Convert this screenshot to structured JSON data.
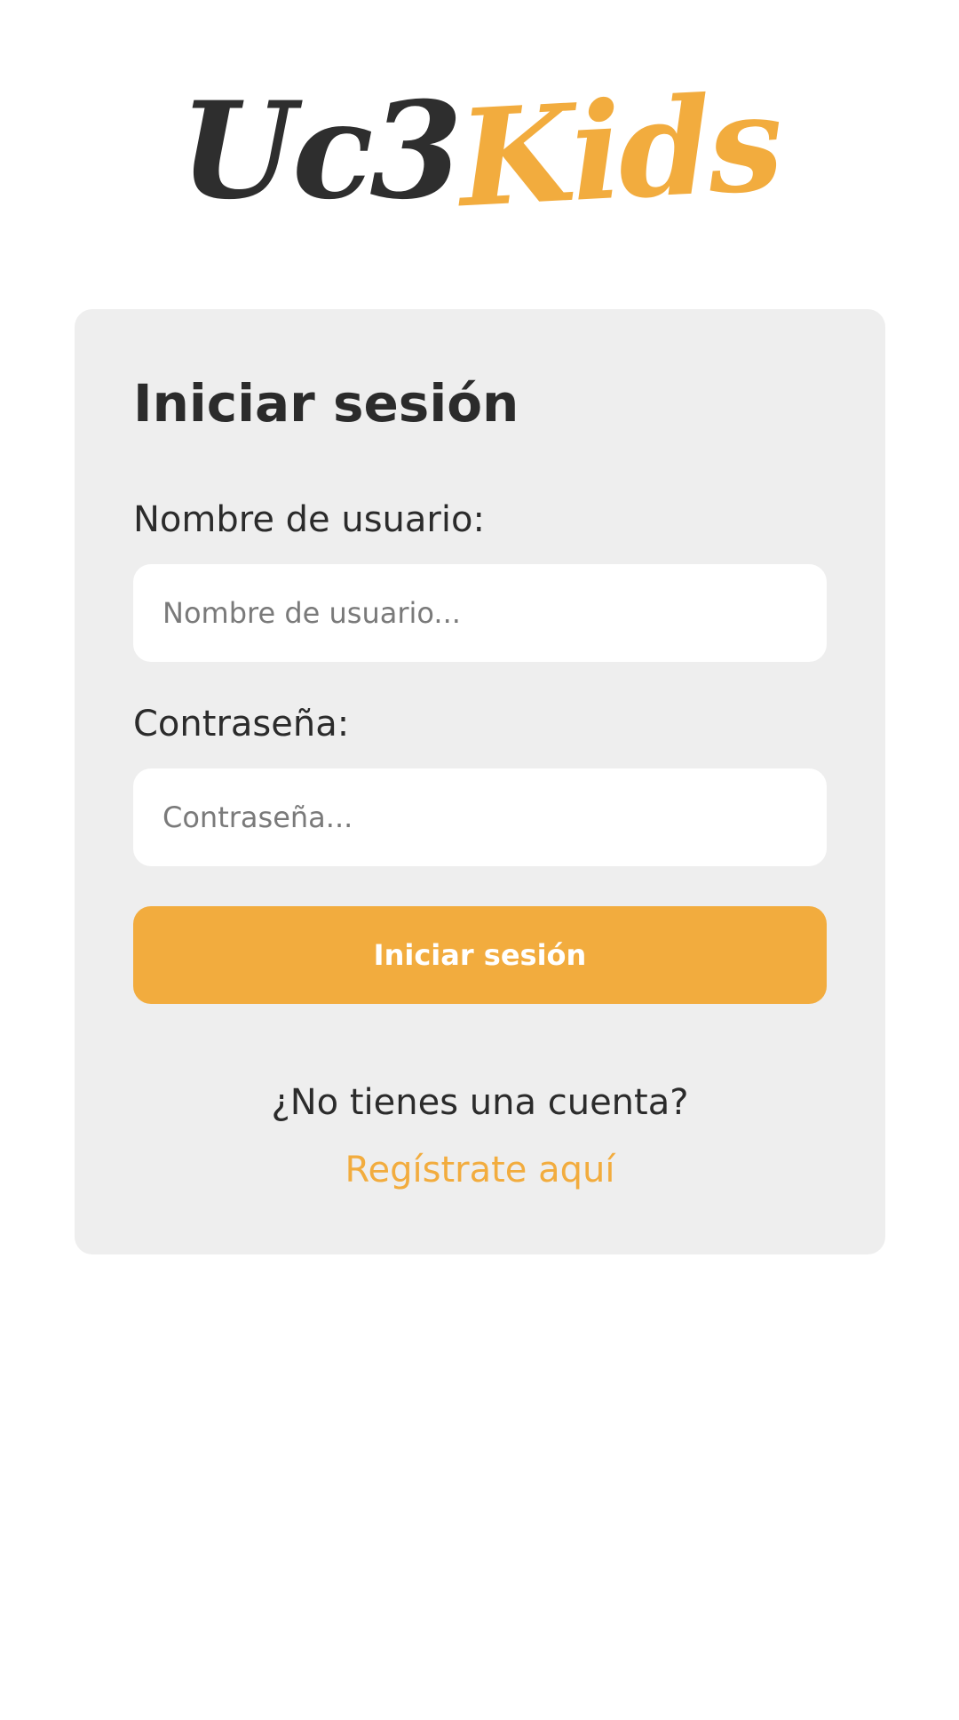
{
  "logo": {
    "part1": "Uc3",
    "part2": "Kids"
  },
  "colors": {
    "accent": "#f2ac3e",
    "card_background": "#eeeeee",
    "text": "#2b2b2b",
    "placeholder": "#7a7a7a"
  },
  "login": {
    "title": "Iniciar sesión",
    "username_label": "Nombre de usuario:",
    "username_placeholder": "Nombre de usuario...",
    "username_value": "",
    "password_label": "Contraseña:",
    "password_placeholder": "Contraseña...",
    "password_value": "",
    "submit_label": "Iniciar sesión",
    "no_account_text": "¿No tienes una cuenta?",
    "register_link": "Regístrate aquí"
  }
}
